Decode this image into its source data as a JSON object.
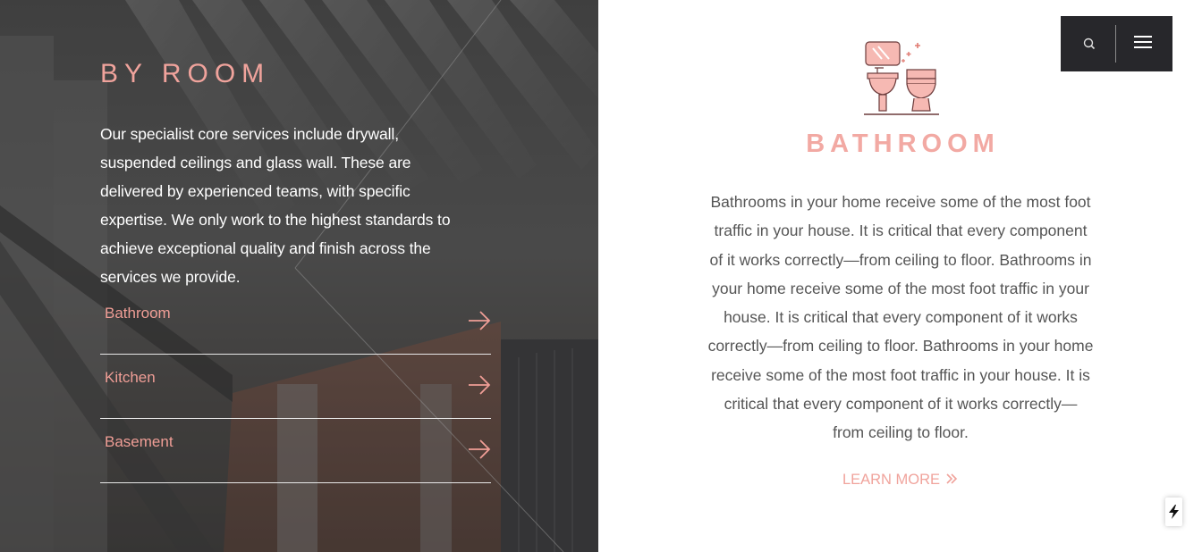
{
  "left": {
    "heading": "BY ROOM",
    "intro_lines": [
      "Our specialist core services include drywall,",
      "suspended ceilings and glass wall. These are",
      "delivered by experienced teams, with specific",
      "expertise. We only work to the highest standards to",
      "achieve exceptional quality and finish across the",
      "services we provide."
    ],
    "rooms": [
      {
        "label": "Bathroom",
        "icon": "arrow-right-icon"
      },
      {
        "label": "Kitchen",
        "icon": "arrow-right-icon"
      },
      {
        "label": "Basement",
        "icon": "arrow-right-icon"
      }
    ]
  },
  "right": {
    "icon": "bathroom-icon",
    "title": "BATHROOM",
    "description_lines": [
      "Bathrooms in your home receive some of the most foot",
      "traffic in your house. It is critical that every component",
      "of it works correctly—from ceiling to floor. Bathrooms in",
      "your home receive some of the most foot traffic in your",
      "house. It is critical that every component of it works",
      "correctly—from ceiling to floor. Bathrooms in your home",
      "receive some of the most foot traffic in your house. It is",
      "critical that every component of it works correctly—",
      "from ceiling to floor."
    ],
    "learn_more": "LEARN MORE",
    "learn_more_icon": "double-chevron-right-icon"
  },
  "header": {
    "search_icon": "search-icon",
    "menu_icon": "hamburger-menu-icon"
  },
  "floating": {
    "icon": "lightning-icon"
  },
  "colors": {
    "accent": "#f0a39c",
    "dark_box": "#27272b",
    "body_text": "#555555"
  }
}
